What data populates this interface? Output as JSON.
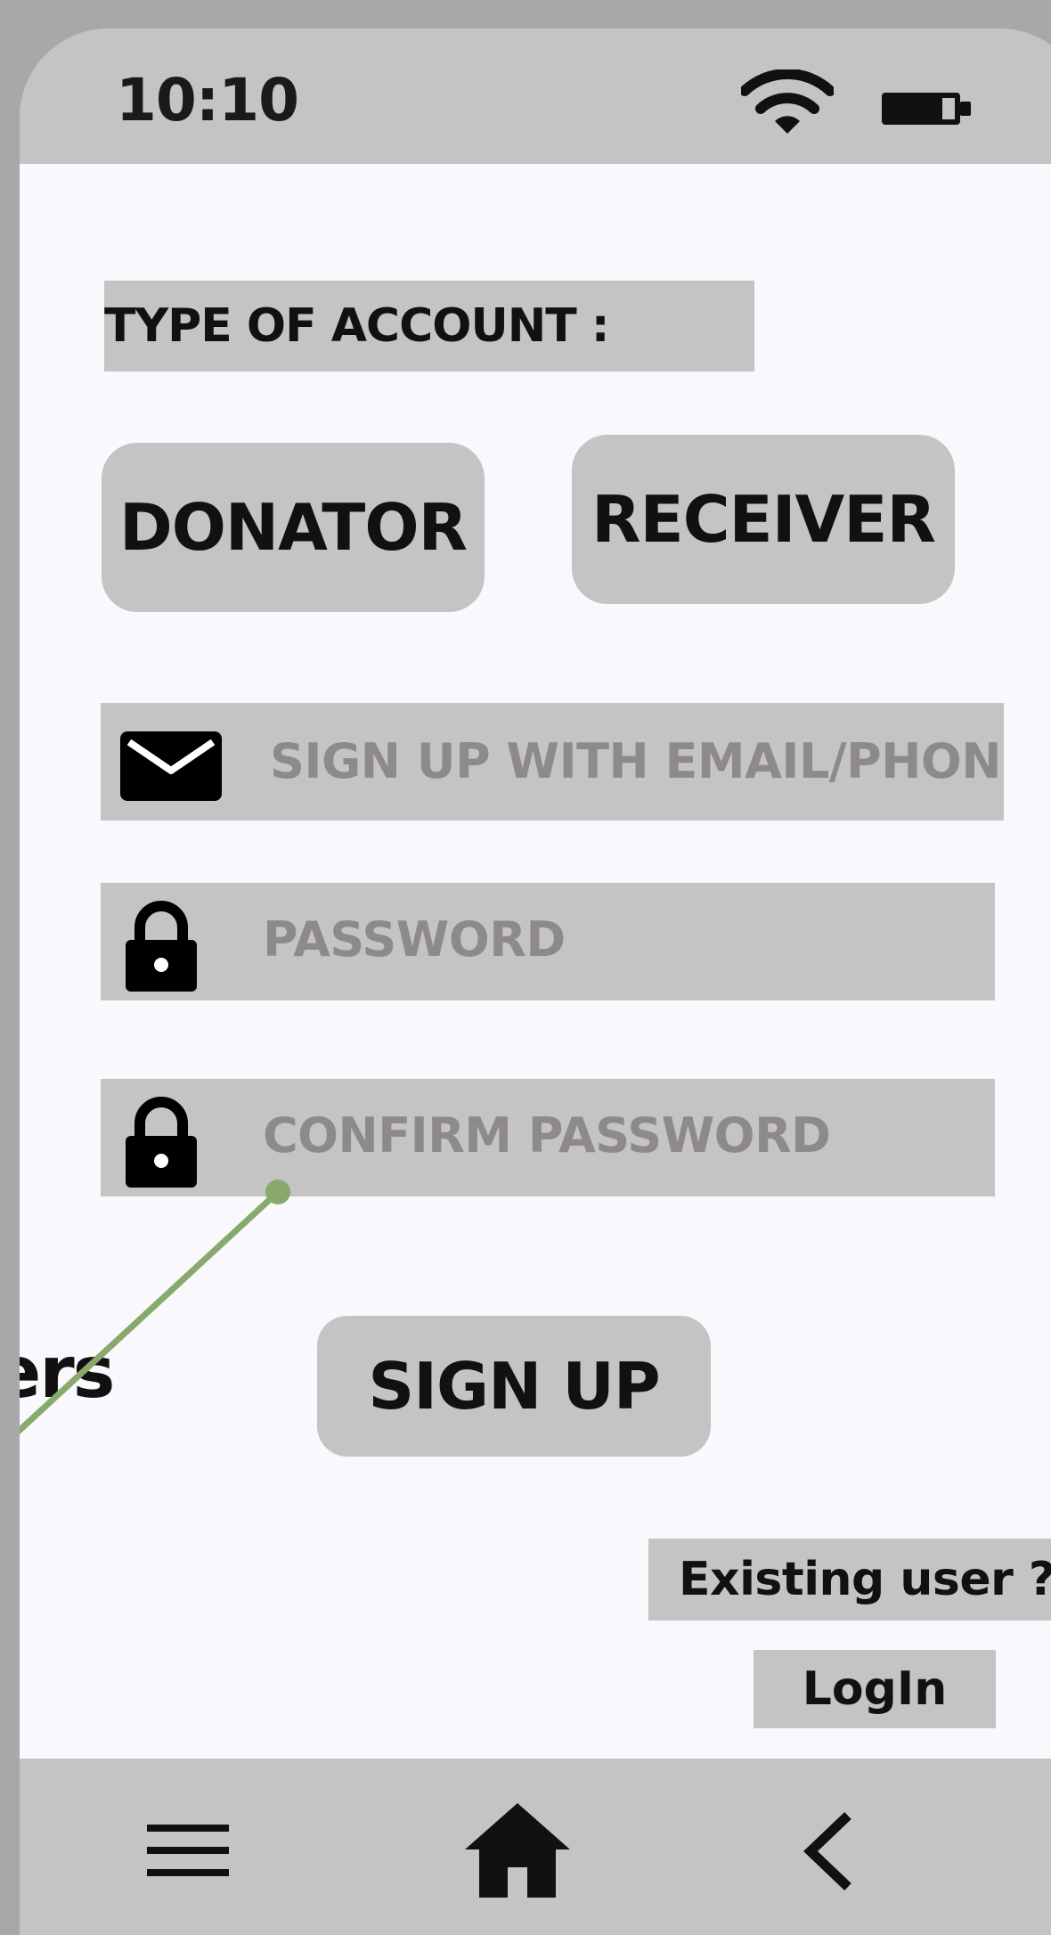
{
  "status_bar": {
    "time": "10:10",
    "wifi_icon": "wifi-icon",
    "battery_icon": "battery-icon"
  },
  "account_type": {
    "label": "TYPE OF ACCOUNT :",
    "options": [
      "DONATOR",
      "RECEIVER"
    ]
  },
  "form": {
    "email_placeholder": "SIGN UP WITH EMAIL/PHONE",
    "password_placeholder": "PASSWORD",
    "confirm_placeholder": "CONFIRM PASSWORD",
    "email_icon": "envelope-icon",
    "lock_icon": "lock-icon"
  },
  "annotation": {
    "cutoff_text": "ers",
    "line_color": "#88a86c"
  },
  "actions": {
    "signup_label": "SIGN UP",
    "existing_user": "Existing user ?",
    "login_label": "LogIn"
  },
  "nav": {
    "menu_icon": "hamburger-menu-icon",
    "home_icon": "home-icon",
    "back_icon": "chevron-left-icon"
  },
  "colors": {
    "frame": "#a7a8aa",
    "panel": "#c4c4c4",
    "screen": "#f9f9fd",
    "placeholder_text": "#8e8a8a"
  }
}
